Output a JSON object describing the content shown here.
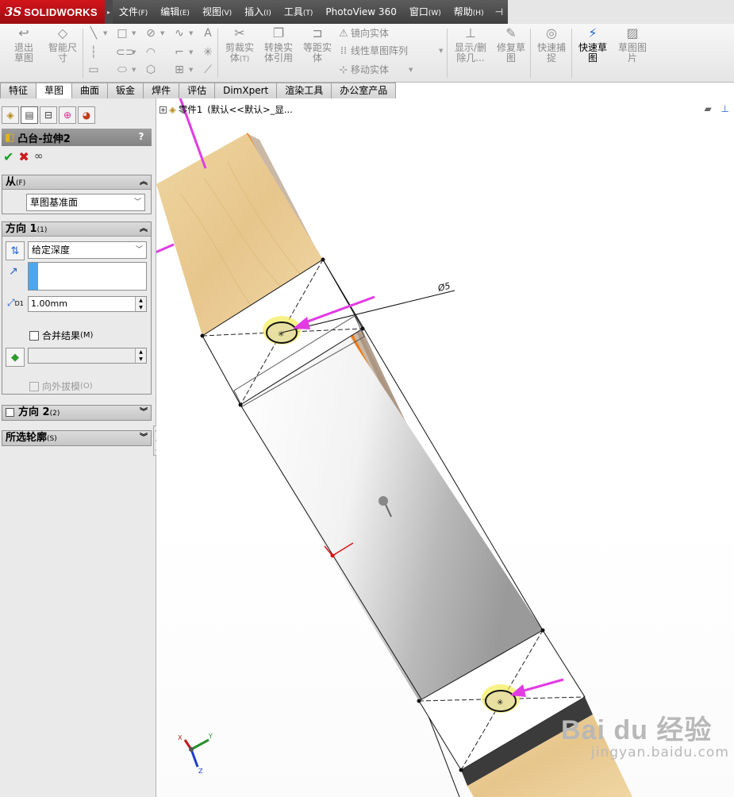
{
  "app": {
    "logo_prefix": "3S",
    "logo_name": "SOLIDWORKS"
  },
  "menubar": {
    "items": [
      {
        "label": "文件",
        "key": "(F)"
      },
      {
        "label": "编辑",
        "key": "(E)"
      },
      {
        "label": "视图",
        "key": "(V)"
      },
      {
        "label": "插入",
        "key": "(I)"
      },
      {
        "label": "工具",
        "key": "(T)"
      },
      {
        "label": "PhotoView 360",
        "key": ""
      },
      {
        "label": "窗口",
        "key": "(W)"
      },
      {
        "label": "帮助",
        "key": "(H)"
      }
    ]
  },
  "ribbon": {
    "exit_sketch": "退出草图",
    "smart_dimension": "智能尺寸",
    "trim_entities": "剪裁实体",
    "trim_key": "(T)",
    "convert_entities": "转换实体引用",
    "offset_entities": "等距实体",
    "mirror_entities": "镜向实体",
    "linear_pattern": "线性草图阵列",
    "move_entities": "移动实体",
    "display_delete": "显示/删除几...",
    "repair_sketch": "修复草图",
    "quick_snaps": "快速捕捉",
    "rapid_sketch": "快速草图",
    "sketch_picture": "草图图片"
  },
  "command_tabs": [
    "特征",
    "草图",
    "曲面",
    "钣金",
    "焊件",
    "评估",
    "DimXpert",
    "渲染工具",
    "办公室产品"
  ],
  "property_manager": {
    "title": "凸台-拉伸2",
    "help": "?",
    "from": {
      "label": "从",
      "key": "(F)",
      "value": "草图基准面"
    },
    "direction1": {
      "label": "方向 1",
      "key": "(1)",
      "end_condition": "给定深度",
      "depth": "1.00mm",
      "depth_icon_label": "D1",
      "merge_result": "合并结果",
      "merge_key": "(M)",
      "draft_outward": "向外拔模",
      "draft_key": "(O)"
    },
    "direction2": {
      "label": "方向 2",
      "key": "(2)"
    },
    "selected_contours": {
      "label": "所选轮廓",
      "key": "(S)"
    }
  },
  "feature_tree": {
    "item": "零件1",
    "config": "(默认<<默认>_显..."
  },
  "sketch": {
    "dimension_label": "Ø5"
  },
  "triad": {
    "x": "X",
    "y": "Y",
    "z": "Z"
  },
  "watermark": {
    "brand": "Bai du 经验",
    "url": "jingyan.baidu.com"
  },
  "colors": {
    "accent": "#1f62c9",
    "annotation_arrow": "#e23be3",
    "wood": "#e9c98f",
    "edge_highlight": "#f07a12",
    "hole_highlight": "#f4ec55"
  }
}
